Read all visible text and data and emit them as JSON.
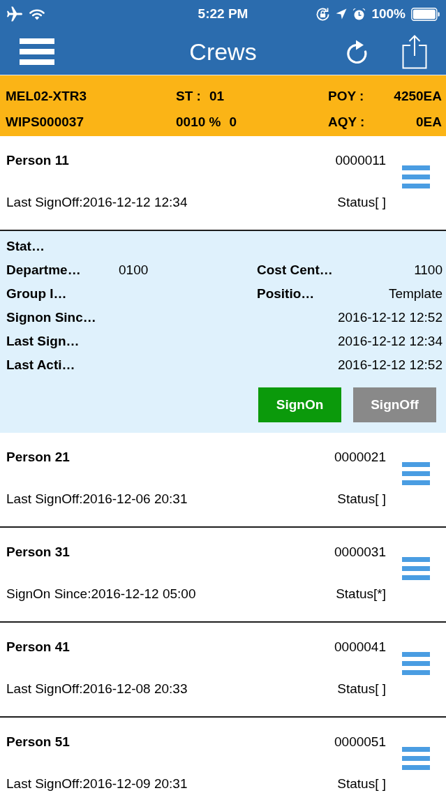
{
  "status_bar": {
    "time": "5:22 PM",
    "battery": "100%"
  },
  "nav_bar": {
    "title": "Crews"
  },
  "order_bar": {
    "order": "MEL02-XTR3",
    "wip": "WIPS000037",
    "fields": [
      {
        "label": "ST :",
        "value": "01"
      },
      {
        "label": "0010 %",
        "value": "0"
      }
    ],
    "quantities": [
      {
        "label": "POY :",
        "value": "4250EA"
      },
      {
        "label": "AQY :",
        "value": "0EA"
      }
    ]
  },
  "crews": [
    {
      "name": "Person 11",
      "number": "0000011",
      "sign_line": "Last SignOff:2016-12-12 12:34",
      "status": "Status[ ]",
      "details": {
        "rows": [
          [
            {
              "label": "Stat…"
            }
          ],
          [
            {
              "label": "Departme…",
              "value": "0100"
            },
            {
              "label": "Cost Cent…",
              "value": "1100"
            }
          ],
          [
            {
              "label": "Group I…"
            },
            {
              "label": "Positio…",
              "value": "Template"
            }
          ],
          [
            {
              "label": "Signon Sinc…",
              "value": "2016-12-12 12:52"
            }
          ],
          [
            {
              "label": "Last Sign…",
              "value": "2016-12-12 12:34"
            }
          ],
          [
            {
              "label": "Last Acti…",
              "value": "2016-12-12 12:52"
            }
          ]
        ],
        "buttons": [
          {
            "label": "SignOn",
            "kind": "sign_on"
          },
          {
            "label": "SignOff",
            "kind": "sign_off"
          }
        ]
      }
    },
    {
      "name": "Person 21",
      "number": "0000021",
      "sign_line": "Last SignOff:2016-12-06 20:31",
      "status": "Status[ ]"
    },
    {
      "name": "Person 31",
      "number": "0000031",
      "sign_line": "SignOn Since:2016-12-12 05:00",
      "status": "Status[*]"
    },
    {
      "name": "Person 41",
      "number": "0000041",
      "sign_line": "Last SignOff:2016-12-08 20:33",
      "status": "Status[ ]"
    },
    {
      "name": "Person 51",
      "number": "0000051",
      "sign_line": "Last SignOff:2016-12-09 20:31",
      "status": "Status[ ]"
    }
  ]
}
